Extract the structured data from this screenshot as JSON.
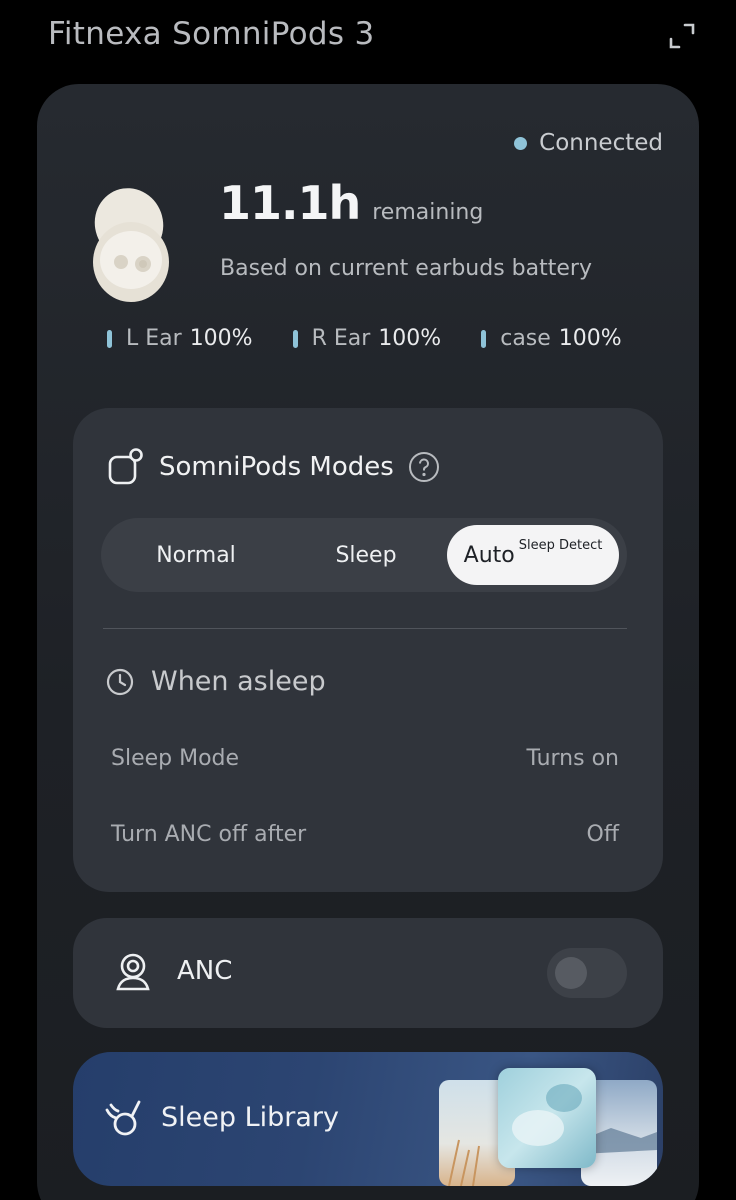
{
  "header": {
    "title": "Fitnexa SomniPods 3",
    "expand_icon": "expand-icon"
  },
  "status": {
    "text": "Connected",
    "dot_color": "#8fc3d8"
  },
  "battery": {
    "hours": "11.1h",
    "suffix": "remaining",
    "subtitle": "Based on current earbuds battery",
    "levels": [
      {
        "label": "L Ear",
        "value": "100%"
      },
      {
        "label": "R Ear",
        "value": "100%"
      },
      {
        "label": "case",
        "value": "100%"
      }
    ]
  },
  "modes": {
    "title": "SomniPods Modes",
    "options": {
      "normal": "Normal",
      "sleep": "Sleep",
      "auto": "Auto",
      "auto_sup": "Sleep Detect"
    },
    "selected": "auto",
    "when_asleep": {
      "title": "When asleep",
      "rows": [
        {
          "label": "Sleep Mode",
          "value": "Turns on"
        },
        {
          "label": "Turn ANC off after",
          "value": "Off"
        }
      ]
    }
  },
  "anc": {
    "label": "ANC",
    "enabled": false
  },
  "library": {
    "label": "Sleep Library"
  }
}
